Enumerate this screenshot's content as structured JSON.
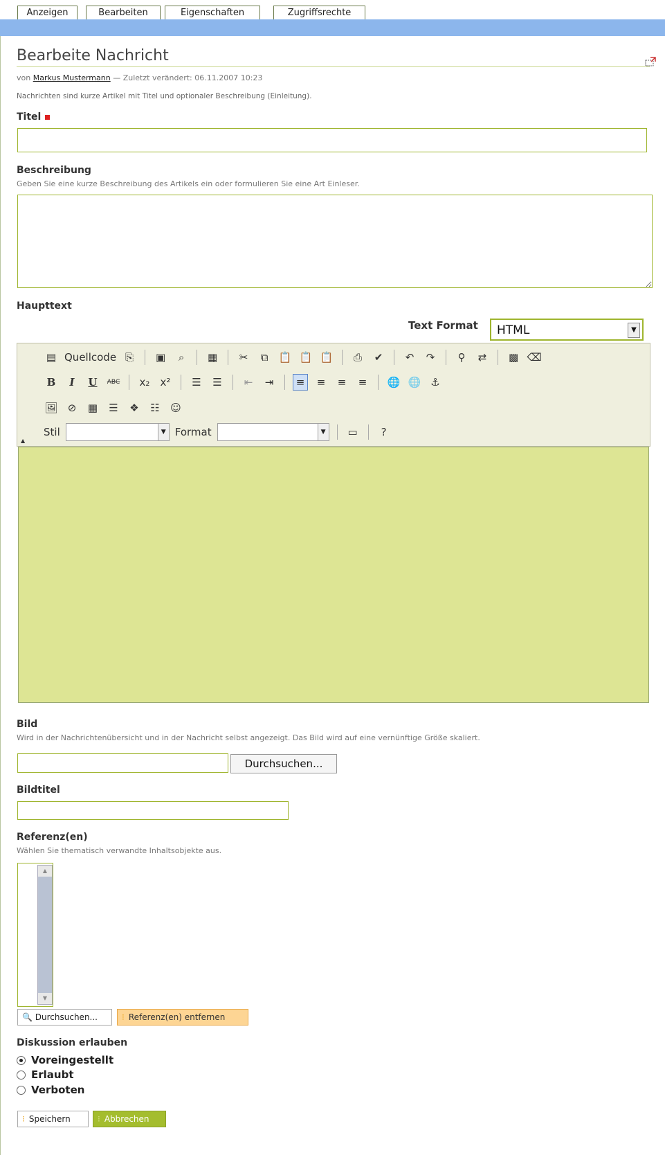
{
  "tabs": [
    "Anzeigen",
    "Bearbeiten",
    "Eigenschaften",
    "Zugriffsrechte"
  ],
  "page_title": "Bearbeite Nachricht",
  "meta": {
    "prefix": "von",
    "author": "Markus Mustermann",
    "modified": "— Zuletzt verändert: 06.11.2007 10:23"
  },
  "description": "Nachrichten sind kurze Artikel mit Titel und optionaler Beschreibung (Einleitung).",
  "titel": {
    "label": "Titel",
    "value": ""
  },
  "beschreibung": {
    "label": "Beschreibung",
    "hint": "Geben Sie eine kurze Beschreibung des Artikels ein oder formulieren Sie eine Art Einleser.",
    "value": ""
  },
  "haupttext": {
    "label": "Haupttext",
    "text_format_label": "Text Format",
    "text_format_value": "HTML",
    "toolbar": {
      "source_label": "Quellcode",
      "style_label": "Stil",
      "format_label": "Format",
      "buttons_row2": [
        "B",
        "I",
        "U",
        "ABC",
        "x₂",
        "x²"
      ]
    }
  },
  "bild": {
    "label": "Bild",
    "hint": "Wird in der Nachrichtenübersicht und in der Nachricht selbst angezeigt. Das Bild wird auf eine vernünftige Größe skaliert.",
    "browse_label": "Durchsuchen..."
  },
  "bildtitel": {
    "label": "Bildtitel",
    "value": ""
  },
  "referenzen": {
    "label": "Referenz(en)",
    "hint": "Wählen Sie thematisch verwandte Inhaltsobjekte aus.",
    "browse_label": "Durchsuchen...",
    "remove_label": "Referenz(en) entfernen"
  },
  "diskussion": {
    "label": "Diskussion erlauben",
    "options": [
      "Voreingestellt",
      "Erlaubt",
      "Verboten"
    ],
    "selected": "Voreingestellt"
  },
  "actions": {
    "save": "Speichern",
    "cancel": "Abbrechen"
  },
  "colors": {
    "accent_green": "#9fb52e",
    "editor_bg": "#dde594",
    "blue_bar": "#8cb6ec",
    "remove_btn": "#fdd594"
  }
}
